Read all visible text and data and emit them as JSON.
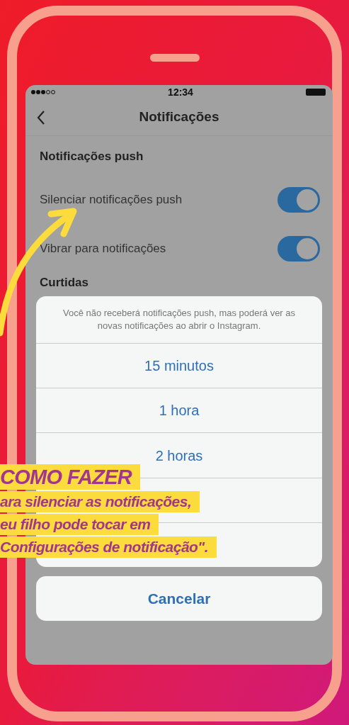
{
  "status_bar": {
    "time": "12:34"
  },
  "nav_bar": {
    "title": "Notificações"
  },
  "sections": [
    {
      "title": "Notificações push",
      "items": [
        {
          "label": "Silenciar notificações push",
          "on": true
        },
        {
          "label": "Vibrar para notificações",
          "on": true
        }
      ]
    },
    {
      "title": "Curtidas"
    }
  ],
  "action_sheet": {
    "message": "Você não receberá notificações push, mas poderá ver as novas notificações ao abrir o Instagram.",
    "options": [
      {
        "label": "15 minutos"
      },
      {
        "label": "1 hora"
      },
      {
        "label": "2 horas"
      }
    ],
    "cancel": "Cancelar"
  },
  "callout": {
    "title": "COMO FAZER",
    "lines": [
      "ara silenciar as notificações,",
      "eu filho pode tocar em",
      "Configurações de notificação\"."
    ]
  }
}
